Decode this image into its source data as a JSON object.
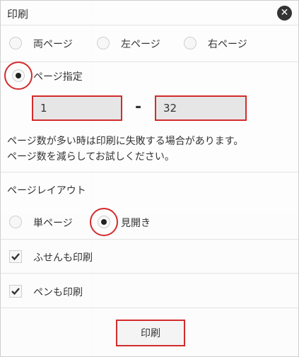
{
  "dialog": {
    "title": "印刷"
  },
  "page_range": {
    "options": [
      "両ページ",
      "左ページ",
      "右ページ"
    ],
    "specified_label": "ページ指定",
    "from": "1",
    "to": "32",
    "separator": "-"
  },
  "note": {
    "line1": "ページ数が多い時は印刷に失敗する場合があります。",
    "line2": "ページ数を減らしてお試しください。"
  },
  "layout": {
    "heading": "ページレイアウト",
    "single": "単ページ",
    "spread": "見開き"
  },
  "options": {
    "sticky_notes": "ふせんも印刷",
    "pen": "ペンも印刷"
  },
  "print_button": "印刷",
  "colors": {
    "highlight": "#d32b2b"
  }
}
